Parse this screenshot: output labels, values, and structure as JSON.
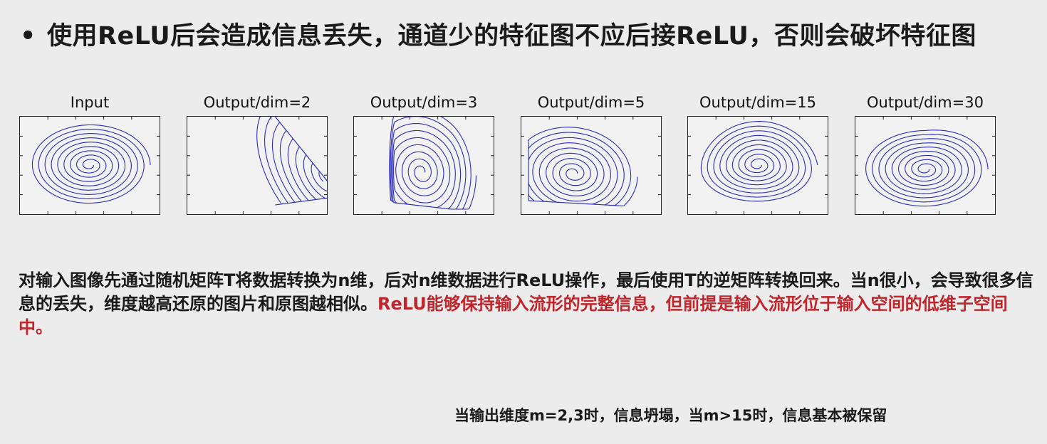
{
  "bullet": {
    "symbol": "•",
    "text": "使用ReLU后会造成信息丢失，通道少的特征图不应后接ReLU，否则会破坏特征图"
  },
  "panels": [
    {
      "title": "Input"
    },
    {
      "title": "Output/dim=2"
    },
    {
      "title": "Output/dim=3"
    },
    {
      "title": "Output/dim=5"
    },
    {
      "title": "Output/dim=15"
    },
    {
      "title": "Output/dim=30"
    }
  ],
  "paragraph": {
    "black": "对输入图像先通过随机矩阵T将数据转换为n维，后对n维数据进行ReLU操作，最后使用T的逆矩阵转换回来。当n很小，会导致很多信息的丢失，维度越高还原的图片和原图越相似。",
    "red": "ReLU能够保持输入流形的完整信息，但前提是输入流形位于输入空间的低维子空间中。"
  },
  "footer": "当输出维度m=2,3时，信息坍塌，当m>15时，信息基本被保留",
  "colors": {
    "curve": "#2b2bb8",
    "highlight": "#c0252c"
  }
}
